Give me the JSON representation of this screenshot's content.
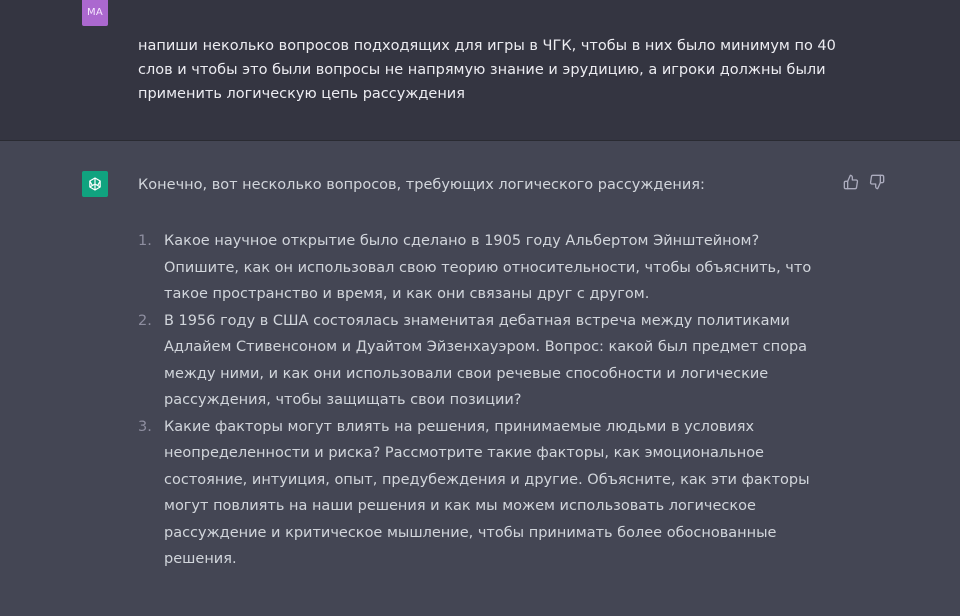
{
  "user_message": {
    "avatar_initials": "MA",
    "avatar_color": "#ab68cf",
    "text": "напиши неколько вопросов подходящих для игры в ЧГК, чтобы в них было минимум по 40 слов и чтобы это были вопросы не напрямую знание и эрудицию, а игроки должны были применить логическую цепь рассуждения"
  },
  "assistant_message": {
    "avatar_icon": "openai-logo-icon",
    "avatar_color": "#10a37f",
    "intro": "Конечно, вот несколько вопросов, требующих логического рассуждения:",
    "feedback": {
      "like_icon": "thumbs-up-icon",
      "dislike_icon": "thumbs-down-icon"
    },
    "items": [
      {
        "number": "1.",
        "text": "Какое научное открытие было сделано в 1905 году Альбертом Эйнштейном? Опишите, как он использовал свою теорию относительности, чтобы объяснить, что такое пространство и время, и как они связаны друг с другом."
      },
      {
        "number": "2.",
        "text": "В 1956 году в США состоялась знаменитая дебатная встреча между политиками Адлайем Стивенсоном и Дуайтом Эйзенхауэром. Вопрос: какой был предмет спора между ними, и как они использовали свои речевые способности и логические рассуждения, чтобы защищать свои позиции?"
      },
      {
        "number": "3.",
        "text": "Какие факторы могут влиять на решения, принимаемые людьми в условиях неопределенности и риска? Рассмотрите такие факторы, как эмоциональное состояние, интуиция, опыт, предубеждения и другие. Объясните, как эти факторы могут повлиять на наши решения и как мы можем использовать логическое рассуждение и критическое мышление, чтобы принимать более обоснованные решения."
      }
    ]
  }
}
